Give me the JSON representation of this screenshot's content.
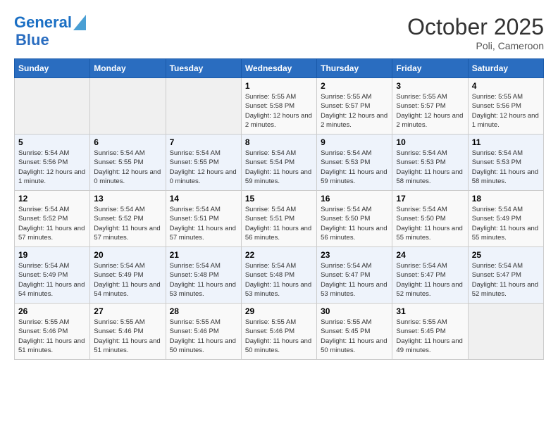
{
  "header": {
    "logo_line1": "General",
    "logo_line2": "Blue",
    "month": "October 2025",
    "location": "Poli, Cameroon"
  },
  "weekdays": [
    "Sunday",
    "Monday",
    "Tuesday",
    "Wednesday",
    "Thursday",
    "Friday",
    "Saturday"
  ],
  "weeks": [
    [
      {
        "day": "",
        "sunrise": "",
        "sunset": "",
        "daylight": ""
      },
      {
        "day": "",
        "sunrise": "",
        "sunset": "",
        "daylight": ""
      },
      {
        "day": "",
        "sunrise": "",
        "sunset": "",
        "daylight": ""
      },
      {
        "day": "1",
        "sunrise": "Sunrise: 5:55 AM",
        "sunset": "Sunset: 5:58 PM",
        "daylight": "Daylight: 12 hours and 2 minutes."
      },
      {
        "day": "2",
        "sunrise": "Sunrise: 5:55 AM",
        "sunset": "Sunset: 5:57 PM",
        "daylight": "Daylight: 12 hours and 2 minutes."
      },
      {
        "day": "3",
        "sunrise": "Sunrise: 5:55 AM",
        "sunset": "Sunset: 5:57 PM",
        "daylight": "Daylight: 12 hours and 2 minutes."
      },
      {
        "day": "4",
        "sunrise": "Sunrise: 5:55 AM",
        "sunset": "Sunset: 5:56 PM",
        "daylight": "Daylight: 12 hours and 1 minute."
      }
    ],
    [
      {
        "day": "5",
        "sunrise": "Sunrise: 5:54 AM",
        "sunset": "Sunset: 5:56 PM",
        "daylight": "Daylight: 12 hours and 1 minute."
      },
      {
        "day": "6",
        "sunrise": "Sunrise: 5:54 AM",
        "sunset": "Sunset: 5:55 PM",
        "daylight": "Daylight: 12 hours and 0 minutes."
      },
      {
        "day": "7",
        "sunrise": "Sunrise: 5:54 AM",
        "sunset": "Sunset: 5:55 PM",
        "daylight": "Daylight: 12 hours and 0 minutes."
      },
      {
        "day": "8",
        "sunrise": "Sunrise: 5:54 AM",
        "sunset": "Sunset: 5:54 PM",
        "daylight": "Daylight: 11 hours and 59 minutes."
      },
      {
        "day": "9",
        "sunrise": "Sunrise: 5:54 AM",
        "sunset": "Sunset: 5:53 PM",
        "daylight": "Daylight: 11 hours and 59 minutes."
      },
      {
        "day": "10",
        "sunrise": "Sunrise: 5:54 AM",
        "sunset": "Sunset: 5:53 PM",
        "daylight": "Daylight: 11 hours and 58 minutes."
      },
      {
        "day": "11",
        "sunrise": "Sunrise: 5:54 AM",
        "sunset": "Sunset: 5:53 PM",
        "daylight": "Daylight: 11 hours and 58 minutes."
      }
    ],
    [
      {
        "day": "12",
        "sunrise": "Sunrise: 5:54 AM",
        "sunset": "Sunset: 5:52 PM",
        "daylight": "Daylight: 11 hours and 57 minutes."
      },
      {
        "day": "13",
        "sunrise": "Sunrise: 5:54 AM",
        "sunset": "Sunset: 5:52 PM",
        "daylight": "Daylight: 11 hours and 57 minutes."
      },
      {
        "day": "14",
        "sunrise": "Sunrise: 5:54 AM",
        "sunset": "Sunset: 5:51 PM",
        "daylight": "Daylight: 11 hours and 57 minutes."
      },
      {
        "day": "15",
        "sunrise": "Sunrise: 5:54 AM",
        "sunset": "Sunset: 5:51 PM",
        "daylight": "Daylight: 11 hours and 56 minutes."
      },
      {
        "day": "16",
        "sunrise": "Sunrise: 5:54 AM",
        "sunset": "Sunset: 5:50 PM",
        "daylight": "Daylight: 11 hours and 56 minutes."
      },
      {
        "day": "17",
        "sunrise": "Sunrise: 5:54 AM",
        "sunset": "Sunset: 5:50 PM",
        "daylight": "Daylight: 11 hours and 55 minutes."
      },
      {
        "day": "18",
        "sunrise": "Sunrise: 5:54 AM",
        "sunset": "Sunset: 5:49 PM",
        "daylight": "Daylight: 11 hours and 55 minutes."
      }
    ],
    [
      {
        "day": "19",
        "sunrise": "Sunrise: 5:54 AM",
        "sunset": "Sunset: 5:49 PM",
        "daylight": "Daylight: 11 hours and 54 minutes."
      },
      {
        "day": "20",
        "sunrise": "Sunrise: 5:54 AM",
        "sunset": "Sunset: 5:49 PM",
        "daylight": "Daylight: 11 hours and 54 minutes."
      },
      {
        "day": "21",
        "sunrise": "Sunrise: 5:54 AM",
        "sunset": "Sunset: 5:48 PM",
        "daylight": "Daylight: 11 hours and 53 minutes."
      },
      {
        "day": "22",
        "sunrise": "Sunrise: 5:54 AM",
        "sunset": "Sunset: 5:48 PM",
        "daylight": "Daylight: 11 hours and 53 minutes."
      },
      {
        "day": "23",
        "sunrise": "Sunrise: 5:54 AM",
        "sunset": "Sunset: 5:47 PM",
        "daylight": "Daylight: 11 hours and 53 minutes."
      },
      {
        "day": "24",
        "sunrise": "Sunrise: 5:54 AM",
        "sunset": "Sunset: 5:47 PM",
        "daylight": "Daylight: 11 hours and 52 minutes."
      },
      {
        "day": "25",
        "sunrise": "Sunrise: 5:54 AM",
        "sunset": "Sunset: 5:47 PM",
        "daylight": "Daylight: 11 hours and 52 minutes."
      }
    ],
    [
      {
        "day": "26",
        "sunrise": "Sunrise: 5:55 AM",
        "sunset": "Sunset: 5:46 PM",
        "daylight": "Daylight: 11 hours and 51 minutes."
      },
      {
        "day": "27",
        "sunrise": "Sunrise: 5:55 AM",
        "sunset": "Sunset: 5:46 PM",
        "daylight": "Daylight: 11 hours and 51 minutes."
      },
      {
        "day": "28",
        "sunrise": "Sunrise: 5:55 AM",
        "sunset": "Sunset: 5:46 PM",
        "daylight": "Daylight: 11 hours and 50 minutes."
      },
      {
        "day": "29",
        "sunrise": "Sunrise: 5:55 AM",
        "sunset": "Sunset: 5:46 PM",
        "daylight": "Daylight: 11 hours and 50 minutes."
      },
      {
        "day": "30",
        "sunrise": "Sunrise: 5:55 AM",
        "sunset": "Sunset: 5:45 PM",
        "daylight": "Daylight: 11 hours and 50 minutes."
      },
      {
        "day": "31",
        "sunrise": "Sunrise: 5:55 AM",
        "sunset": "Sunset: 5:45 PM",
        "daylight": "Daylight: 11 hours and 49 minutes."
      },
      {
        "day": "",
        "sunrise": "",
        "sunset": "",
        "daylight": ""
      }
    ]
  ]
}
